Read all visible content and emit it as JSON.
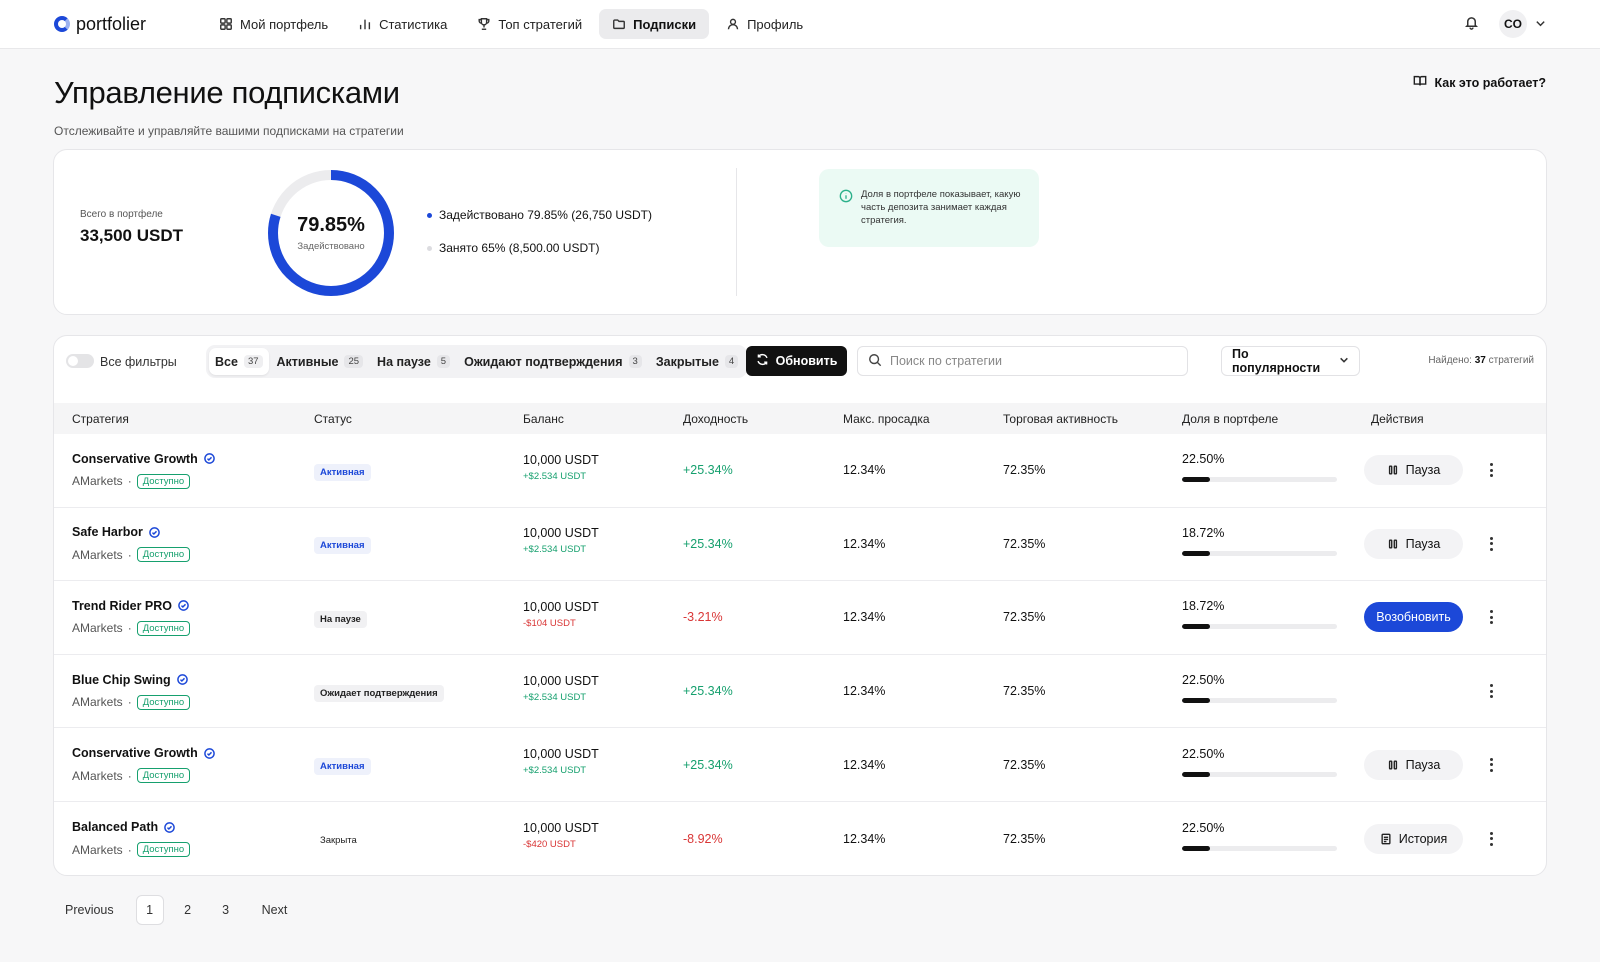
{
  "app": {
    "name": "portfolier"
  },
  "nav": {
    "items": [
      {
        "label": "Мой портфель",
        "icon": "grid-icon",
        "active": false
      },
      {
        "label": "Статистика",
        "icon": "bar-chart-icon",
        "active": false
      },
      {
        "label": "Топ стратегий",
        "icon": "trophy-icon",
        "active": false
      },
      {
        "label": "Подписки",
        "icon": "folder-icon",
        "active": true
      },
      {
        "label": "Профиль",
        "icon": "user-icon",
        "active": false
      }
    ]
  },
  "user": {
    "initials": "CO"
  },
  "page": {
    "title": "Управление подписками",
    "subtitle": "Отслеживайте и управляйте вашими подписками на стратегии",
    "how_it_works": "Как это работает?"
  },
  "summary": {
    "total_label": "Всего в портфеле",
    "total_value": "33,500 USDT",
    "donut_percent": "79.85%",
    "donut_fraction": 0.7985,
    "donut_caption": "Задействовано",
    "legend_used": "Задействовано 79.85% (26,750 USDT)",
    "legend_taken": "Занято 65% (8,500.00 USDT)",
    "info_text": "Доля в портфеле показывает, какую часть депозита занимает каждая стратегия.",
    "colors": {
      "accent": "#1c48d8",
      "track": "#ececee"
    }
  },
  "filters": {
    "toggle_label": "Все фильтры",
    "segments": [
      {
        "label": "Все",
        "count": "37",
        "active": true
      },
      {
        "label": "Активные",
        "count": "25",
        "active": false
      },
      {
        "label": "На паузе",
        "count": "5",
        "active": false
      },
      {
        "label": "Ожидают подтверждения",
        "count": "3",
        "active": false
      },
      {
        "label": "Закрытые",
        "count": "4",
        "active": false
      }
    ],
    "refresh_label": "Обновить",
    "search_placeholder": "Поиск по стратегии",
    "sort_label": "По популярности",
    "found_prefix": "Найдено:",
    "found_count": "37",
    "found_suffix": "стратегий"
  },
  "table": {
    "headers": [
      "Стратегия",
      "Статус",
      "Баланс",
      "Доходность",
      "Макс. просадка",
      "Торговая активность",
      "Доля в портфеле",
      "Действия"
    ],
    "rows": [
      {
        "name": "Conservative Growth",
        "broker": "AMarkets",
        "badge": "Доступно",
        "status": "Активная",
        "status_type": "active",
        "balance": "10,000 USDT",
        "pnl": "+$2.534 USDT",
        "pnl_positive": true,
        "yield": "+25.34%",
        "drawdown": "12.34%",
        "activity": "72.35%",
        "share": "22.50%",
        "share_fraction": 0.18,
        "action": "Пауза",
        "action_type": "pause"
      },
      {
        "name": "Safe Harbor",
        "broker": "AMarkets",
        "badge": "Доступно",
        "status": "Активная",
        "status_type": "active",
        "balance": "10,000 USDT",
        "pnl": "+$2.534 USDT",
        "pnl_positive": true,
        "yield": "+25.34%",
        "drawdown": "12.34%",
        "activity": "72.35%",
        "share": "18.72%",
        "share_fraction": 0.18,
        "action": "Пауза",
        "action_type": "pause"
      },
      {
        "name": "Trend Rider PRO",
        "broker": "AMarkets",
        "badge": "Доступно",
        "status": "На паузе",
        "status_type": "paused",
        "balance": "10,000 USDT",
        "pnl": "-$104 USDT",
        "pnl_positive": false,
        "yield": "-3.21%",
        "drawdown": "12.34%",
        "activity": "72.35%",
        "share": "18.72%",
        "share_fraction": 0.18,
        "action": "Возобновить",
        "action_type": "resume"
      },
      {
        "name": "Blue Chip Swing",
        "broker": "AMarkets",
        "badge": "Доступно",
        "status": "Ожидает подтверждения",
        "status_type": "pending",
        "balance": "10,000 USDT",
        "pnl": "+$2.534 USDT",
        "pnl_positive": true,
        "yield": "+25.34%",
        "drawdown": "12.34%",
        "activity": "72.35%",
        "share": "22.50%",
        "share_fraction": 0.18,
        "action": "",
        "action_type": "none"
      },
      {
        "name": "Conservative Growth",
        "broker": "AMarkets",
        "badge": "Доступно",
        "status": "Активная",
        "status_type": "active",
        "balance": "10,000 USDT",
        "pnl": "+$2.534 USDT",
        "pnl_positive": true,
        "yield": "+25.34%",
        "drawdown": "12.34%",
        "activity": "72.35%",
        "share": "22.50%",
        "share_fraction": 0.18,
        "action": "Пауза",
        "action_type": "pause"
      },
      {
        "name": "Balanced Path",
        "broker": "AMarkets",
        "badge": "Доступно",
        "status": "Закрыта",
        "status_type": "closed",
        "balance": "10,000 USDT",
        "pnl": "-$420 USDT",
        "pnl_positive": false,
        "yield": "-8.92%",
        "drawdown": "12.34%",
        "activity": "72.35%",
        "share": "22.50%",
        "share_fraction": 0.18,
        "action": "История",
        "action_type": "history"
      }
    ]
  },
  "pagination": {
    "previous": "Previous",
    "pages": [
      "1",
      "2",
      "3"
    ],
    "current": "1",
    "next": "Next"
  }
}
